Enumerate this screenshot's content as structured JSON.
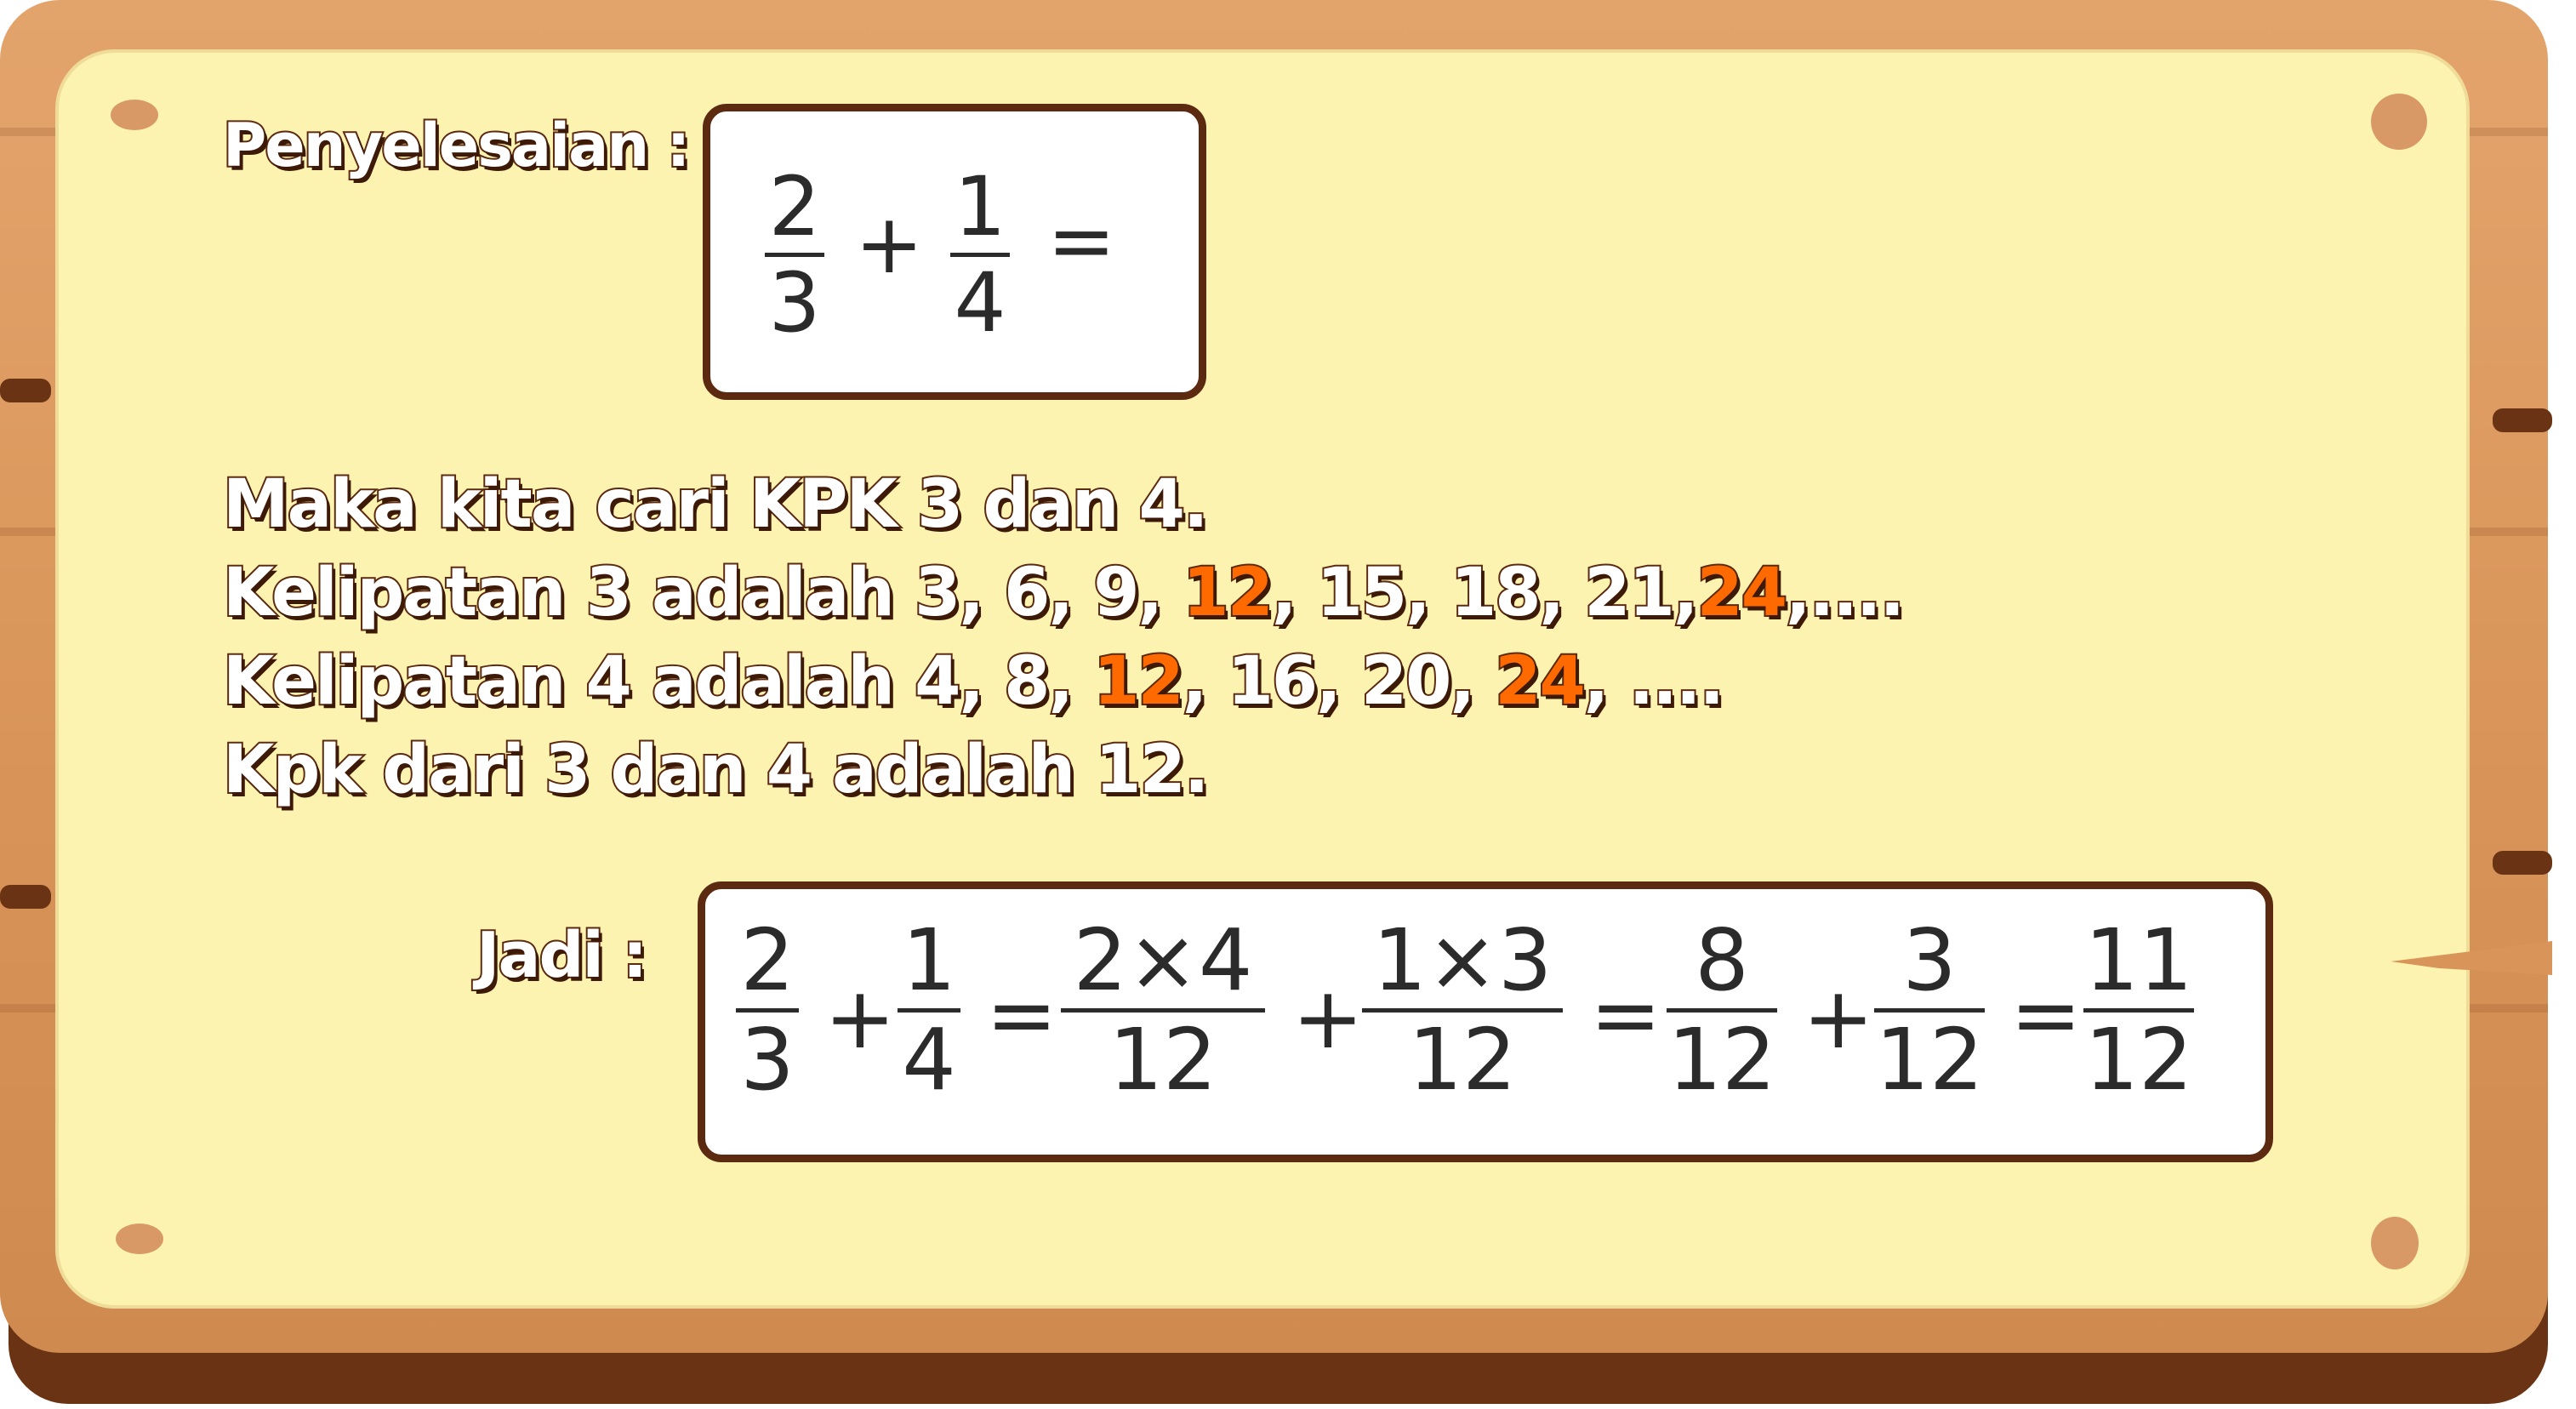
{
  "colors": {
    "wood": "#d99559",
    "wood_shadow": "#6a3414",
    "paper": "#fdf3b1",
    "label_stroke": "#5b2a10",
    "highlight": "#ff6a00"
  },
  "heading": {
    "penyelesaian": "Penyelesaian :",
    "jadi": "Jadi :"
  },
  "problem": {
    "a_num": "2",
    "a_den": "3",
    "plus": "+",
    "b_num": "1",
    "b_den": "4",
    "equals": "="
  },
  "lines": {
    "line1": "Maka kita cari KPK 3 dan 4.",
    "line2_pre": "Kelipatan 3 adalah 3, 6, 9, ",
    "line2_hl1": "12",
    "line2_mid": ", 15, 18, 21,",
    "line2_hl2": "24",
    "line2_post": ",....",
    "line3_pre": "Kelipatan 4 adalah 4, 8, ",
    "line3_hl1": "12",
    "line3_mid": ", 16, 20, ",
    "line3_hl2": "24",
    "line3_post": ", ....",
    "line4": "Kpk dari 3 dan 4 adalah 12."
  },
  "answer": {
    "f1_num": "2",
    "f1_den": "3",
    "op1": "+",
    "f2_num": "1",
    "f2_den": "4",
    "op2": "=",
    "f3_num": "2×4",
    "f3_den": "12",
    "op3": "+",
    "f4_num": "1×3",
    "f4_den": "12",
    "op4": "=",
    "f5_num": "8",
    "f5_den": "12",
    "op5": "+",
    "f6_num": "3",
    "f6_den": "12",
    "op6": "=",
    "f7_num": "11",
    "f7_den": "12"
  }
}
